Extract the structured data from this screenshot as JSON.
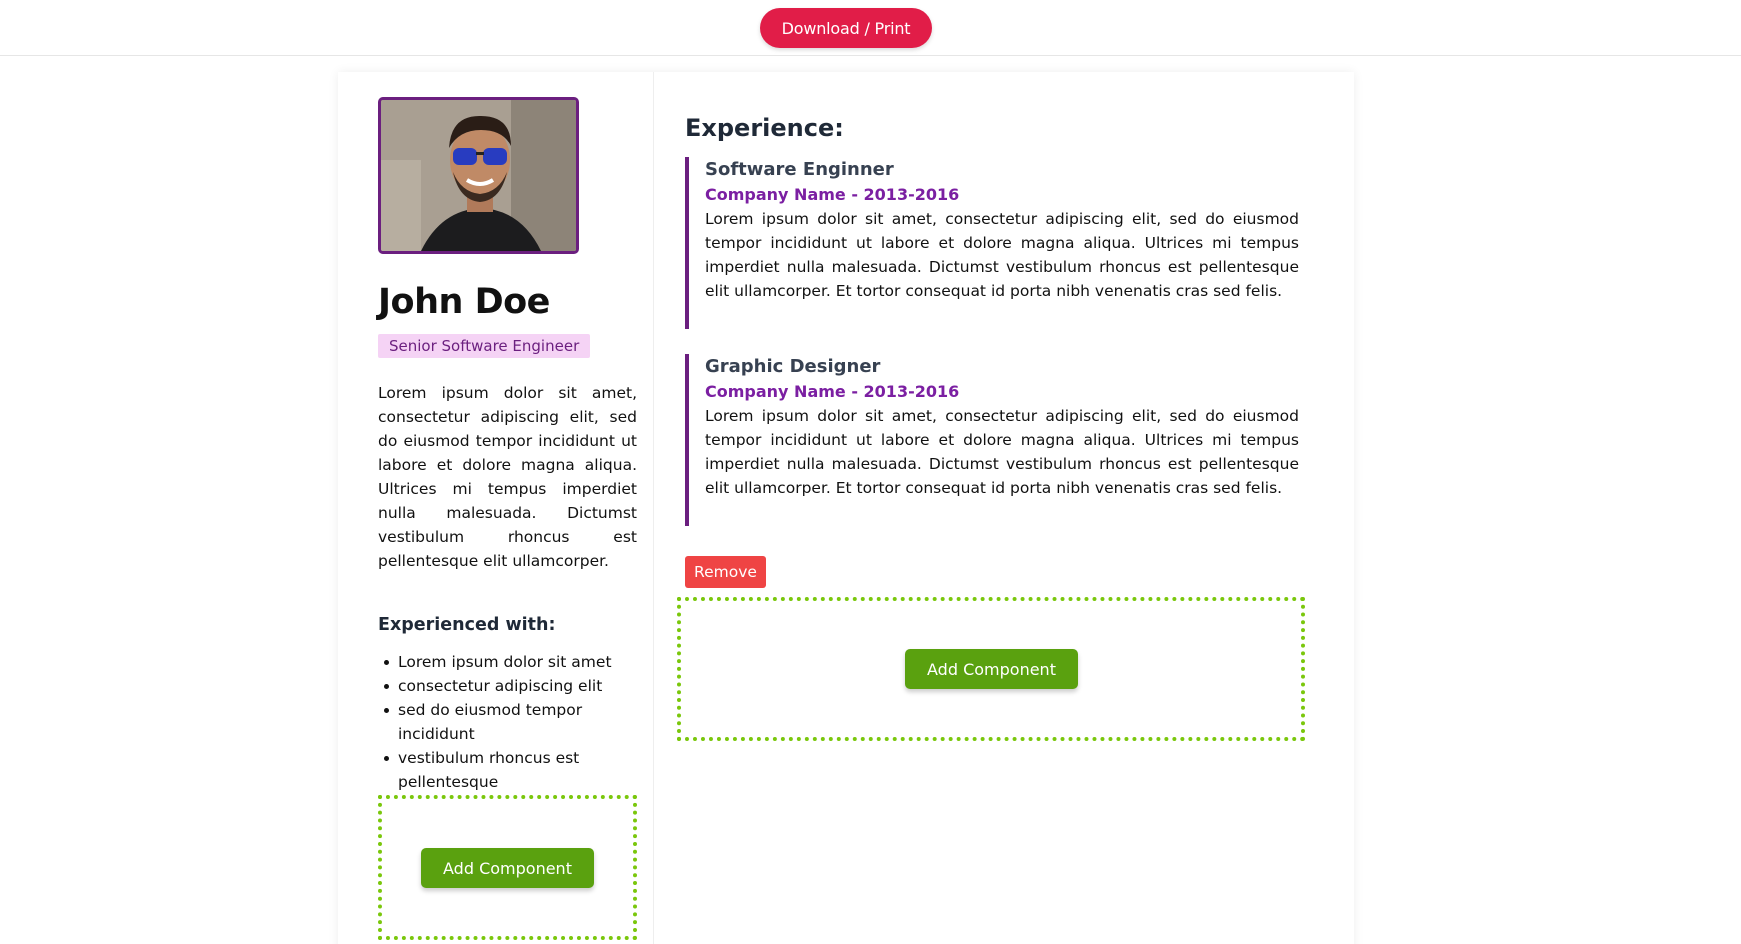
{
  "toolbar": {
    "download_label": "Download / Print"
  },
  "profile": {
    "name": "John Doe",
    "role": "Senior Software Engineer",
    "bio": "Lorem ipsum dolor sit amet, consectetur adipiscing elit, sed do eiusmod tempor incididunt ut labore et dolore magna aliqua. Ultrices mi tempus imperdiet nulla malesuada. Dictumst vestibulum rhoncus est pellentesque elit ullamcorper.",
    "avatar_icon": "avatar-photo-icon"
  },
  "skills": {
    "title": "Experienced with:",
    "items": [
      "Lorem ipsum dolor sit amet",
      "consectetur adipiscing elit",
      "sed do eiusmod tempor incididunt",
      "vestibulum rhoncus est pellentesque"
    ]
  },
  "experience": {
    "title": "Experience:",
    "items": [
      {
        "title": "Software Enginner",
        "company": "Company Name - 2013-2016",
        "description": "Lorem ipsum dolor sit amet, consectetur adipiscing elit, sed do eiusmod tempor incididunt ut labore et dolore magna aliqua. Ultrices mi tempus imperdiet nulla malesuada. Dictumst vestibulum rhoncus est pellentesque elit ullamcorper. Et tortor consequat id porta nibh venenatis cras sed felis."
      },
      {
        "title": "Graphic Designer",
        "company": "Company Name - 2013-2016",
        "description": "Lorem ipsum dolor sit amet, consectetur adipiscing elit, sed do eiusmod tempor incididunt ut labore et dolore magna aliqua. Ultrices mi tempus imperdiet nulla malesuada. Dictumst vestibulum rhoncus est pellentesque elit ullamcorper. Et tortor consequat id porta nibh venenatis cras sed felis."
      }
    ]
  },
  "actions": {
    "remove_label": "Remove",
    "add_component_label": "Add Component"
  },
  "colors": {
    "download_button": "#e11d48",
    "accent_purple": "#6b1f7f",
    "company_purple": "#7b1fa2",
    "badge_bg": "#f5d3f5",
    "add_button": "#5aa10f",
    "dropzone_border": "#7ac70c",
    "remove_button": "#ef4444"
  }
}
